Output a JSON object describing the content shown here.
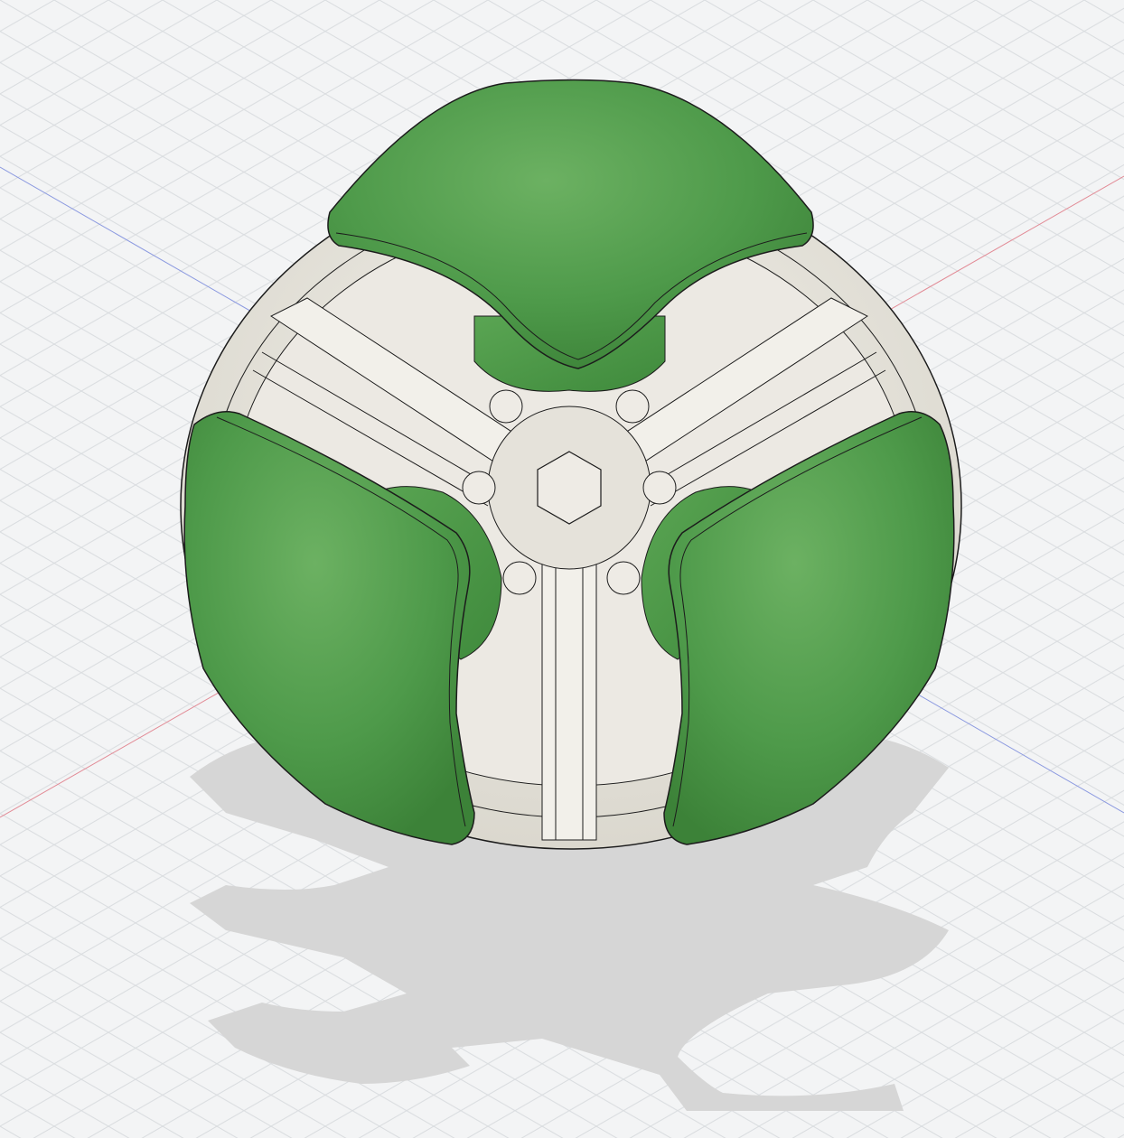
{
  "scene": {
    "view": "isometric-3d-viewport",
    "model": "three-lobed-sphere-assembly",
    "background_color": "#f3f4f5",
    "grid_color": "#d9dcdf",
    "axis_colors": {
      "x": "#d8485a",
      "y": "#5e74d6"
    },
    "body_color": "#e8e6df",
    "cap_color": "#4e9a4a",
    "cap_highlight_color": "#6cb162",
    "edge_color": "#1c1c1c",
    "shadow_color": "#d6d6d6"
  }
}
